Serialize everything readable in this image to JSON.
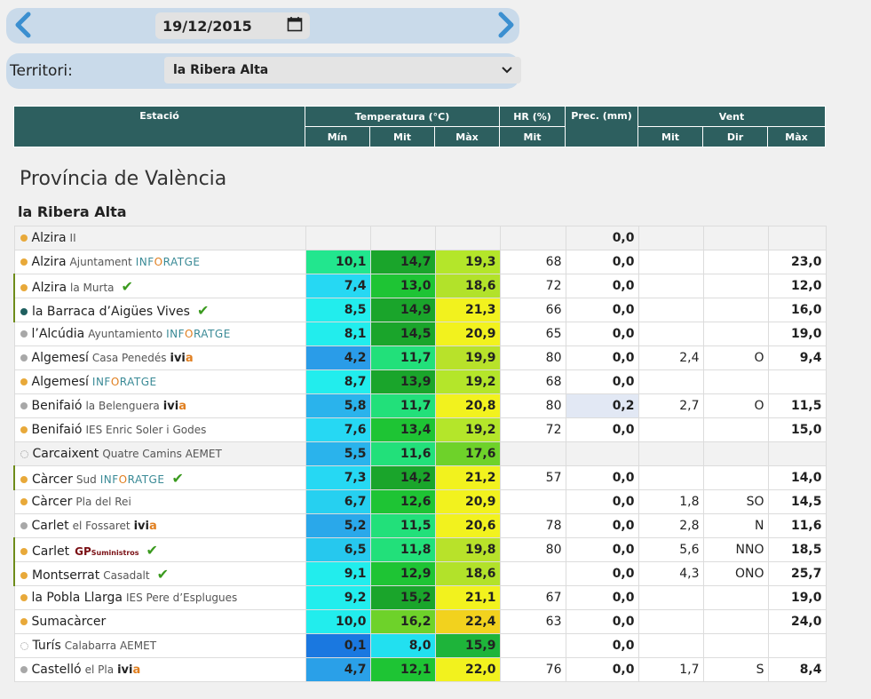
{
  "date_nav": {
    "date": "19/12/2015"
  },
  "territory": {
    "label": "Territori:",
    "selected": "la Ribera Alta"
  },
  "header": {
    "groups": [
      "Estació",
      "Temperatura (°C)",
      "HR (%)",
      "Prec. (mm)",
      "Vent"
    ],
    "subs": [
      "Mín",
      "Mit",
      "Màx",
      "Mit",
      "Mit",
      "Dir",
      "Màx"
    ]
  },
  "province": "Província de València",
  "region": "la Ribera Alta",
  "colors": {
    "header_bg": "#2d5f5f",
    "bar_bg": "#c9daea",
    "arrow": "#3b8fd0",
    "dot_orange": "#e8a93a",
    "dot_grey": "#a8a8a8",
    "dot_teal": "#1f5f5f",
    "check": "#3a9a1e"
  },
  "stations": [
    {
      "name": "Alzira",
      "sub": "II",
      "net": "",
      "dot": "orange",
      "mark": false,
      "check": false,
      "tmin": "",
      "tmit": "",
      "tmax": "",
      "cmin": "",
      "cmit": "",
      "cmax": "",
      "hr": "",
      "prec": "0,0",
      "vmit": "",
      "vdir": "",
      "vmax": "",
      "row": "grey"
    },
    {
      "name": "Alzira",
      "sub": "Ajuntament",
      "net": "inf",
      "dot": "orange",
      "mark": false,
      "check": false,
      "tmin": "10,1",
      "tmit": "14,7",
      "tmax": "19,3",
      "cmin": "#22e68e",
      "cmit": "#1aa52b",
      "cmax": "#b4e62a",
      "hr": "68",
      "prec": "0,0",
      "vmit": "",
      "vdir": "",
      "vmax": "23,0",
      "row": "white"
    },
    {
      "name": "Alzira",
      "sub": "la Murta",
      "net": "",
      "dot": "orange",
      "mark": true,
      "check": true,
      "tmin": "7,4",
      "tmit": "13,0",
      "tmax": "18,6",
      "cmin": "#26d8f3",
      "cmit": "#1ec434",
      "cmax": "#b2e22a",
      "hr": "72",
      "prec": "0,0",
      "vmit": "",
      "vdir": "",
      "vmax": "12,0",
      "row": "white"
    },
    {
      "name": "la Barraca d’Aigües Vives",
      "sub": "",
      "net": "",
      "dot": "teal",
      "mark": true,
      "check": true,
      "tmin": "8,5",
      "tmit": "14,9",
      "tmax": "21,3",
      "cmin": "#22eded",
      "cmit": "#1aa52b",
      "cmax": "#f2f21e",
      "hr": "66",
      "prec": "0,0",
      "vmit": "",
      "vdir": "",
      "vmax": "16,0",
      "row": "white"
    },
    {
      "name": "l’Alcúdia",
      "sub": "Ayuntamiento",
      "net": "inf",
      "dot": "grey",
      "mark": false,
      "check": false,
      "tmin": "8,1",
      "tmit": "14,5",
      "tmax": "20,9",
      "cmin": "#22eded",
      "cmit": "#1aa52b",
      "cmax": "#f2f21e",
      "hr": "65",
      "prec": "0,0",
      "vmit": "",
      "vdir": "",
      "vmax": "19,0",
      "row": "white"
    },
    {
      "name": "Algemesí",
      "sub": "Casa Penedés",
      "net": "ivia",
      "dot": "grey",
      "mark": false,
      "check": false,
      "tmin": "4,2",
      "tmit": "11,7",
      "tmax": "19,9",
      "cmin": "#2a9ce8",
      "cmit": "#22e07a",
      "cmax": "#b8e22a",
      "hr": "80",
      "prec": "0,0",
      "vmit": "2,4",
      "vdir": "O",
      "vmax": "9,4",
      "row": "white"
    },
    {
      "name": "Algemesí",
      "sub": "",
      "net": "inf",
      "dot": "orange",
      "mark": false,
      "check": false,
      "tmin": "8,7",
      "tmit": "13,9",
      "tmax": "19,2",
      "cmin": "#22eded",
      "cmit": "#1aa52b",
      "cmax": "#b4e62a",
      "hr": "68",
      "prec": "0,0",
      "vmit": "",
      "vdir": "",
      "vmax": "",
      "row": "white"
    },
    {
      "name": "Benifaió",
      "sub": "la Belenguera",
      "net": "ivia",
      "dot": "grey",
      "mark": false,
      "check": false,
      "tmin": "5,8",
      "tmit": "11,7",
      "tmax": "20,8",
      "cmin": "#2ab3ec",
      "cmit": "#22e07a",
      "cmax": "#f2f21e",
      "hr": "80",
      "prec": "0,2",
      "vmit": "2,7",
      "vdir": "O",
      "vmax": "11,5",
      "row": "white",
      "precbg": "#e2e8f4"
    },
    {
      "name": "Benifaió",
      "sub": "IES Enric Soler i Godes",
      "net": "",
      "dot": "orange",
      "mark": false,
      "check": false,
      "tmin": "7,6",
      "tmit": "13,4",
      "tmax": "19,2",
      "cmin": "#26d8f3",
      "cmit": "#1ec434",
      "cmax": "#b4e62a",
      "hr": "72",
      "prec": "0,0",
      "vmit": "",
      "vdir": "",
      "vmax": "15,0",
      "row": "white"
    },
    {
      "name": "Carcaixent",
      "sub": "Quatre Camins AEMET",
      "net": "",
      "dot": "empty",
      "mark": false,
      "check": false,
      "tmin": "5,5",
      "tmit": "11,6",
      "tmax": "17,6",
      "cmin": "#2ab3ec",
      "cmit": "#22e07a",
      "cmax": "#6ed22a",
      "hr": "",
      "prec": "",
      "vmit": "",
      "vdir": "",
      "vmax": "",
      "row": "grey"
    },
    {
      "name": "Càrcer",
      "sub": "Sud",
      "net": "inf",
      "dot": "orange",
      "mark": true,
      "check": true,
      "tmin": "7,3",
      "tmit": "14,2",
      "tmax": "21,2",
      "cmin": "#26d8f3",
      "cmit": "#1aa52b",
      "cmax": "#f2f21e",
      "hr": "57",
      "prec": "0,0",
      "vmit": "",
      "vdir": "",
      "vmax": "14,0",
      "row": "white"
    },
    {
      "name": "Càrcer",
      "sub": "Pla del Rei",
      "net": "",
      "dot": "orange",
      "mark": false,
      "check": false,
      "tmin": "6,7",
      "tmit": "12,6",
      "tmax": "20,9",
      "cmin": "#26d0f0",
      "cmit": "#1ec434",
      "cmax": "#f2f21e",
      "hr": "",
      "prec": "0,0",
      "vmit": "1,8",
      "vdir": "SO",
      "vmax": "14,5",
      "row": "white"
    },
    {
      "name": "Carlet",
      "sub": "el Fossaret",
      "net": "ivia",
      "dot": "grey",
      "mark": false,
      "check": false,
      "tmin": "5,2",
      "tmit": "11,5",
      "tmax": "20,6",
      "cmin": "#2aa8ea",
      "cmit": "#22e07a",
      "cmax": "#f2f21e",
      "hr": "78",
      "prec": "0,0",
      "vmit": "2,8",
      "vdir": "N",
      "vmax": "11,6",
      "row": "white"
    },
    {
      "name": "Carlet",
      "sub": "",
      "net": "gp",
      "dot": "orange",
      "mark": true,
      "check": true,
      "tmin": "6,5",
      "tmit": "11,8",
      "tmax": "19,8",
      "cmin": "#26c8ee",
      "cmit": "#22e07a",
      "cmax": "#b8e22a",
      "hr": "80",
      "prec": "0,0",
      "vmit": "5,6",
      "vdir": "NNO",
      "vmax": "18,5",
      "row": "white"
    },
    {
      "name": "Montserrat",
      "sub": "Casadalt",
      "net": "",
      "dot": "orange",
      "mark": true,
      "check": true,
      "tmin": "9,1",
      "tmit": "12,9",
      "tmax": "18,6",
      "cmin": "#22eded",
      "cmit": "#1ec434",
      "cmax": "#b2e22a",
      "hr": "",
      "prec": "0,0",
      "vmit": "4,3",
      "vdir": "ONO",
      "vmax": "25,7",
      "row": "white"
    },
    {
      "name": "la Pobla Llarga",
      "sub": "IES Pere d’Esplugues",
      "net": "",
      "dot": "orange",
      "mark": false,
      "check": false,
      "tmin": "9,2",
      "tmit": "15,2",
      "tmax": "21,1",
      "cmin": "#22eded",
      "cmit": "#1aa52b",
      "cmax": "#f2f21e",
      "hr": "67",
      "prec": "0,0",
      "vmit": "",
      "vdir": "",
      "vmax": "19,0",
      "row": "white"
    },
    {
      "name": "Sumacàrcer",
      "sub": "",
      "net": "",
      "dot": "orange",
      "mark": false,
      "check": false,
      "tmin": "10,0",
      "tmit": "16,2",
      "tmax": "22,4",
      "cmin": "#22eded",
      "cmit": "#6ed22a",
      "cmax": "#f2d21e",
      "hr": "63",
      "prec": "0,0",
      "vmit": "",
      "vdir": "",
      "vmax": "24,0",
      "row": "white"
    },
    {
      "name": "Turís",
      "sub": "Calabarra AEMET",
      "net": "",
      "dot": "empty",
      "mark": false,
      "check": false,
      "tmin": "0,1",
      "tmit": "8,0",
      "tmax": "15,9",
      "cmin": "#1a78e0",
      "cmit": "#22e0f0",
      "cmax": "#1eb43a",
      "hr": "",
      "prec": "0,0",
      "vmit": "",
      "vdir": "",
      "vmax": "",
      "row": "white"
    },
    {
      "name": "Castelló",
      "sub": "el Pla",
      "net": "ivia",
      "dot": "grey",
      "mark": false,
      "check": false,
      "tmin": "4,7",
      "tmit": "12,1",
      "tmax": "22,0",
      "cmin": "#2aa0e8",
      "cmit": "#1ec434",
      "cmax": "#f2f21e",
      "hr": "76",
      "prec": "0,0",
      "vmit": "1,7",
      "vdir": "S",
      "vmax": "8,4",
      "row": "white"
    }
  ]
}
